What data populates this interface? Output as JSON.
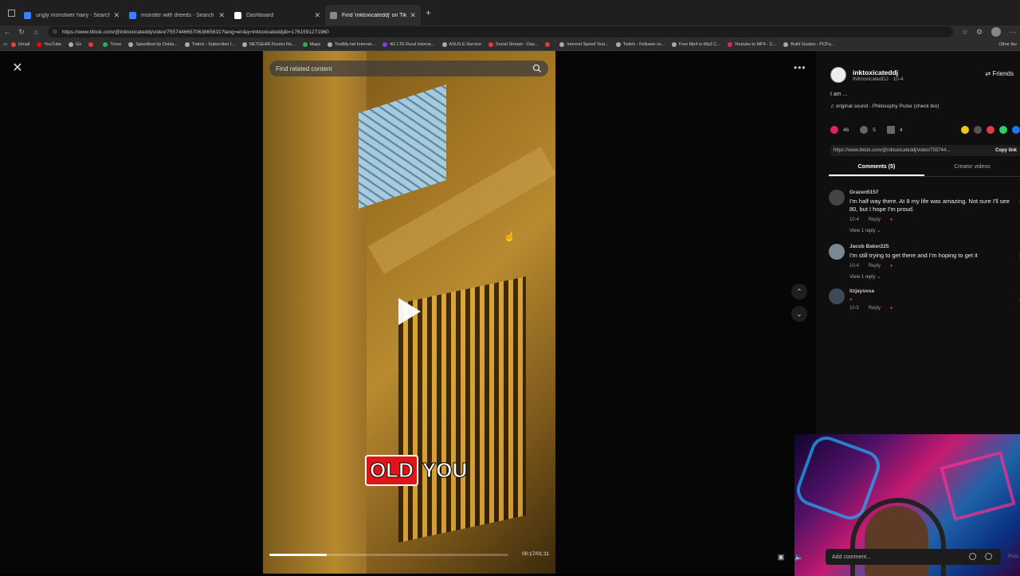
{
  "browser": {
    "tabs": [
      {
        "title": "ungly monstwer hairy - Search Im",
        "color": "#3b82f6"
      },
      {
        "title": "monster with dreeds - Search Im",
        "color": "#3b82f6"
      },
      {
        "title": "Dashboard",
        "color": "#ffffff"
      },
      {
        "title": "Find 'inktoxicateddj' on Tik",
        "color": "#888888"
      }
    ],
    "url": "https://www.tiktok.com/@inktoxicateddj/video/7557446657063865631?lang=en&q=inktoxicateddj&t=1761591271960",
    "bookmarks": [
      {
        "label": "Gmail",
        "color": "#ea4335"
      },
      {
        "label": "YouTube",
        "color": "#ff0000"
      },
      {
        "label": "Go",
        "color": "#aaaaaa"
      },
      {
        "label": "",
        "color": "#e53935"
      },
      {
        "label": "Trovo",
        "color": "#1db954"
      },
      {
        "label": "Speedtest by Ookla...",
        "color": "#aaaaaa"
      },
      {
        "label": "Twitch - Subscriber l...",
        "color": "#aaaaaa"
      },
      {
        "label": "NETGEAR Router Re...",
        "color": "#aaaaaa"
      },
      {
        "label": "Maps",
        "color": "#34a853"
      },
      {
        "label": "TestMy.net Internet...",
        "color": "#aaaaaa"
      },
      {
        "label": "4G LTE Rural Interne...",
        "color": "#7b3fe4"
      },
      {
        "label": "ASUS E-Service",
        "color": "#aaaaaa"
      },
      {
        "label": "Social Stream - Das...",
        "color": "#e53935"
      },
      {
        "label": "",
        "color": "#e53935"
      },
      {
        "label": "Internet Speed Test...",
        "color": "#aaaaaa"
      },
      {
        "label": "Twitch - Follower re...",
        "color": "#aaaaaa"
      },
      {
        "label": "Free Mp4 to Mp3 C...",
        "color": "#aaaaaa"
      },
      {
        "label": "Youtube to MP4 - C...",
        "color": "#e91e63"
      },
      {
        "label": "Build Guides - PCPa...",
        "color": "#aaaaaa"
      }
    ],
    "other_bookmarks": "Other fav"
  },
  "search": {
    "placeholder": "Find related content"
  },
  "video": {
    "caption_word1": "OLD",
    "caption_word2": "YOU",
    "timestamp": "00:17/01:11",
    "progress": 0.24
  },
  "author": {
    "username": "inktoxicateddj",
    "subline": "INKtoxicatedDJ · 10-4",
    "friends_label": "Friends",
    "description": "I am ...",
    "sound": "original sound - Philosophy Pulse (check bio)"
  },
  "stats": {
    "likes": "46",
    "comments": "5",
    "saves": "4"
  },
  "share_colors": [
    "#f5c518",
    "#555555",
    "#e53945",
    "#25d366",
    "#1877f2"
  ],
  "link": {
    "text": "https://www.tiktok.com/@inktoxicateddj/video/755744...",
    "copy_label": "Copy link"
  },
  "comment_tabs": {
    "comments": "Comments (5)",
    "creator": "Creator videos"
  },
  "comments": [
    {
      "name": "Grazen5157",
      "text": "I'm half way there. At 8 my life was amazing. Not sure I'll see 80, but I hope I'm proud.",
      "date": "10-4",
      "reply": "Reply",
      "view_replies": "View 1 reply"
    },
    {
      "name": "Jacob Baker225",
      "text": "I'm still trying to get there and I'm hoping to get it",
      "date": "10-4",
      "reply": "Reply",
      "view_replies": "View 1 reply"
    },
    {
      "name": "itzjaysosa",
      "text": "",
      "date": "10-5",
      "reply": "Reply",
      "view_replies": ""
    }
  ],
  "add_comment": {
    "placeholder": "Add comment...",
    "post_label": "Post"
  }
}
